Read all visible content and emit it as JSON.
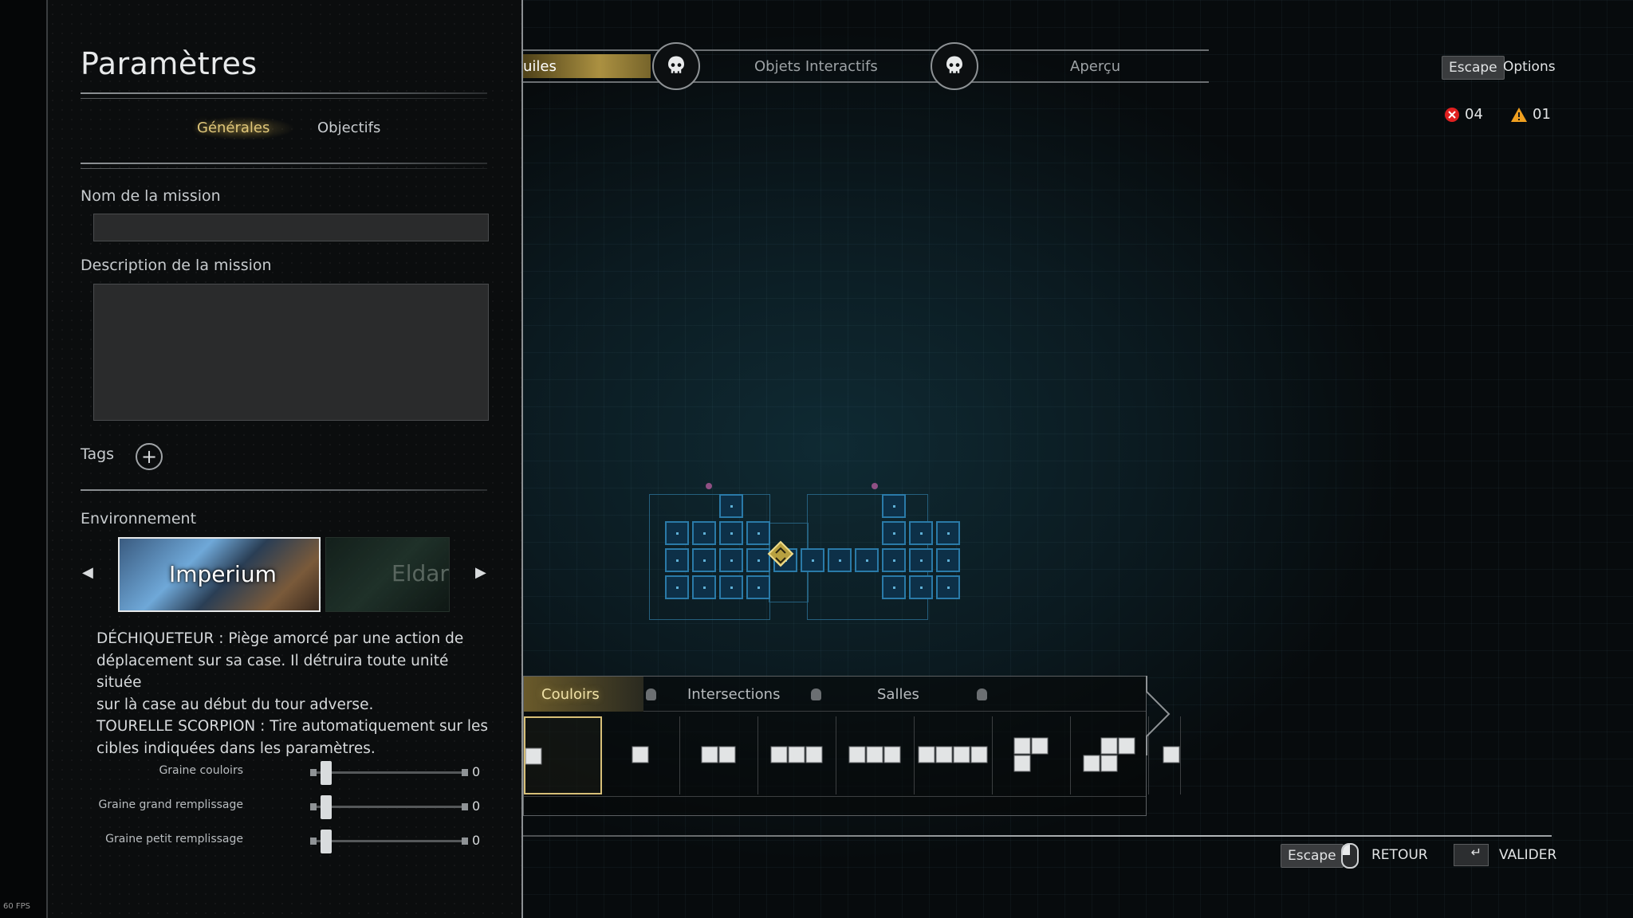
{
  "fps": "60 FPS",
  "panel": {
    "title": "Paramètres",
    "subtabs": [
      {
        "label": "Générales",
        "active": true
      },
      {
        "label": "Objectifs",
        "active": false
      }
    ],
    "mission_name": {
      "label": "Nom de la mission",
      "value": ""
    },
    "mission_description": {
      "label": "Description de la mission",
      "value": ""
    },
    "tags_label": "Tags",
    "environment": {
      "label": "Environnement",
      "options": [
        "Imperium",
        "Eldar"
      ],
      "selected": "Imperium"
    },
    "description_lines": [
      "DÉCHIQUETEUR : Piège amorcé par une action de",
      "déplacement sur sa case. Il détruira toute unité située",
      "sur là case au début du tour adverse.",
      "TOURELLE SCORPION : Tire automatiquement sur les",
      "cibles indiquées dans les paramètres."
    ],
    "sliders": [
      {
        "label": "Graine couloirs",
        "value": "0"
      },
      {
        "label": "Graine grand remplissage",
        "value": "0"
      },
      {
        "label": "Graine petit remplissage",
        "value": "0"
      }
    ]
  },
  "topbar": {
    "tabs": [
      {
        "label": "uiles",
        "active": true
      },
      {
        "label": "Objets Interactifs",
        "active": false
      },
      {
        "label": "Aperçu",
        "active": false
      }
    ]
  },
  "top_right": {
    "escape_key": "Escape",
    "options_label": "Options",
    "errors": "04",
    "warnings": "01"
  },
  "palette": {
    "tabs": [
      {
        "label": "Couloirs",
        "active": true
      },
      {
        "label": "Intersections",
        "active": false
      },
      {
        "label": "Salles",
        "active": false
      }
    ]
  },
  "footer": {
    "escape_key": "Escape",
    "back_label": "RETOUR",
    "enter_key": "↵",
    "validate_label": "VALIDER"
  },
  "colors": {
    "accent_gold": "#d8c078",
    "map_blue": "#2a7aa8",
    "error_red": "#e02020",
    "warning_orange": "#f0a020"
  }
}
